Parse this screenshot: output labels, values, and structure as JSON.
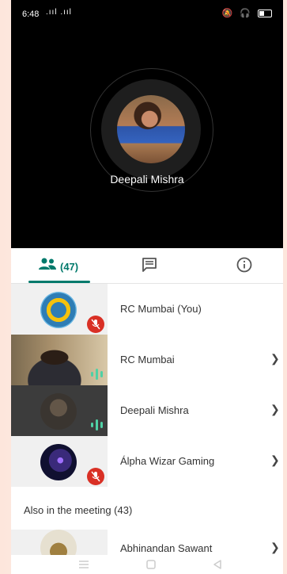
{
  "status_bar": {
    "time": "6:48",
    "signal_text": ".ııl .ııl",
    "icons": [
      "wifi-icon",
      "volte-icon",
      "call-icon",
      "app-icon",
      "mute-icon",
      "headphones-icon",
      "battery-icon"
    ]
  },
  "call": {
    "active_speaker_name": "Deepali Mishra"
  },
  "tabs": {
    "people_count": "(47)",
    "chat_icon": "chat-icon",
    "info_icon": "info-icon",
    "accent_color": "#00796b"
  },
  "participants": [
    {
      "name": "RC Mumbai (You)",
      "muted": true
    },
    {
      "name": "RC Mumbai",
      "speaking": true
    },
    {
      "name": "Deepali Mishra",
      "speaking": true
    },
    {
      "name": "Álpha Wizar Gaming",
      "muted": true
    }
  ],
  "also_in_meeting": {
    "label": "Also in the meeting (43)",
    "first_partial_name": "Abhinandan Sawant"
  },
  "nav_bar": {
    "icons": [
      "menu-icon",
      "home-icon",
      "back-icon"
    ]
  }
}
